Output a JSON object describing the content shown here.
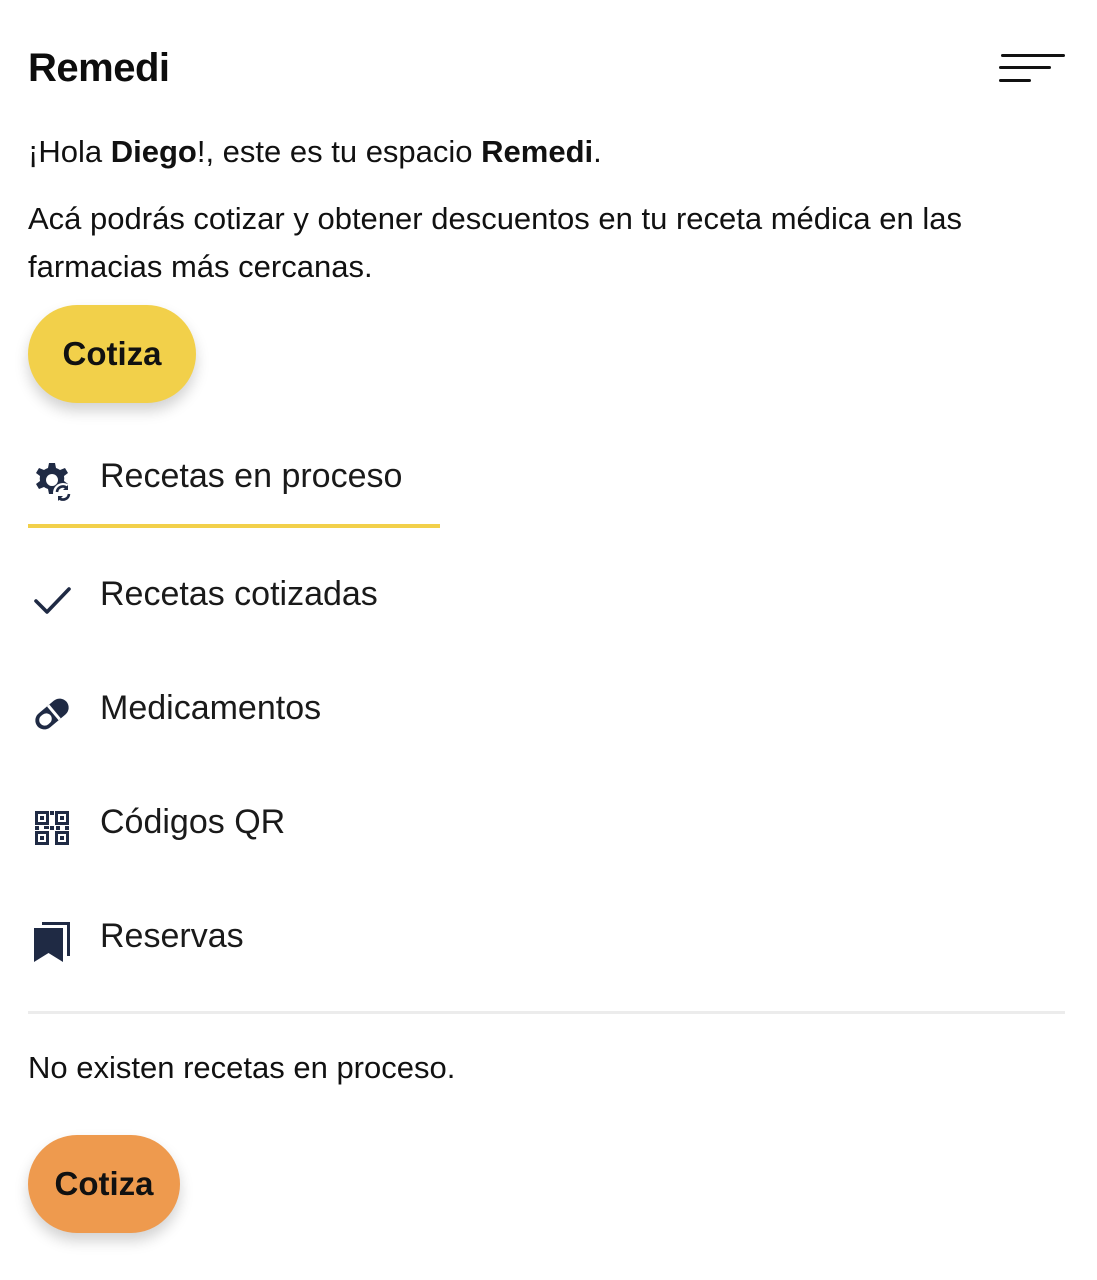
{
  "header": {
    "title": "Remedi",
    "menu_icon": "menu-lines-icon"
  },
  "greeting": {
    "prefix": "¡Hola ",
    "name": "Diego",
    "middle": "!, este es tu espacio ",
    "brand": "Remedi",
    "suffix": "."
  },
  "intro": "Acá podrás cotizar y obtener descuentos en tu receta médica en las farmacias más cercanas.",
  "cta_top": {
    "label": "Cotiza",
    "color": "#f2d04a"
  },
  "tabs": [
    {
      "label": "Recetas en proceso",
      "icon": "gear-sync-icon",
      "active": true
    },
    {
      "label": "Recetas cotizadas",
      "icon": "check-icon",
      "active": false
    },
    {
      "label": "Medicamentos",
      "icon": "pill-icon",
      "active": false
    },
    {
      "label": "Códigos QR",
      "icon": "qr-code-icon",
      "active": false
    },
    {
      "label": "Reservas",
      "icon": "bookmark-icon",
      "active": false
    }
  ],
  "empty_message": "No existen recetas en proceso.",
  "cta_bottom": {
    "label": "Cotiza",
    "color": "#ee9a4e"
  },
  "colors": {
    "accent": "#f2d04a",
    "secondary": "#ee9a4e",
    "icon": "#1f2a44"
  }
}
